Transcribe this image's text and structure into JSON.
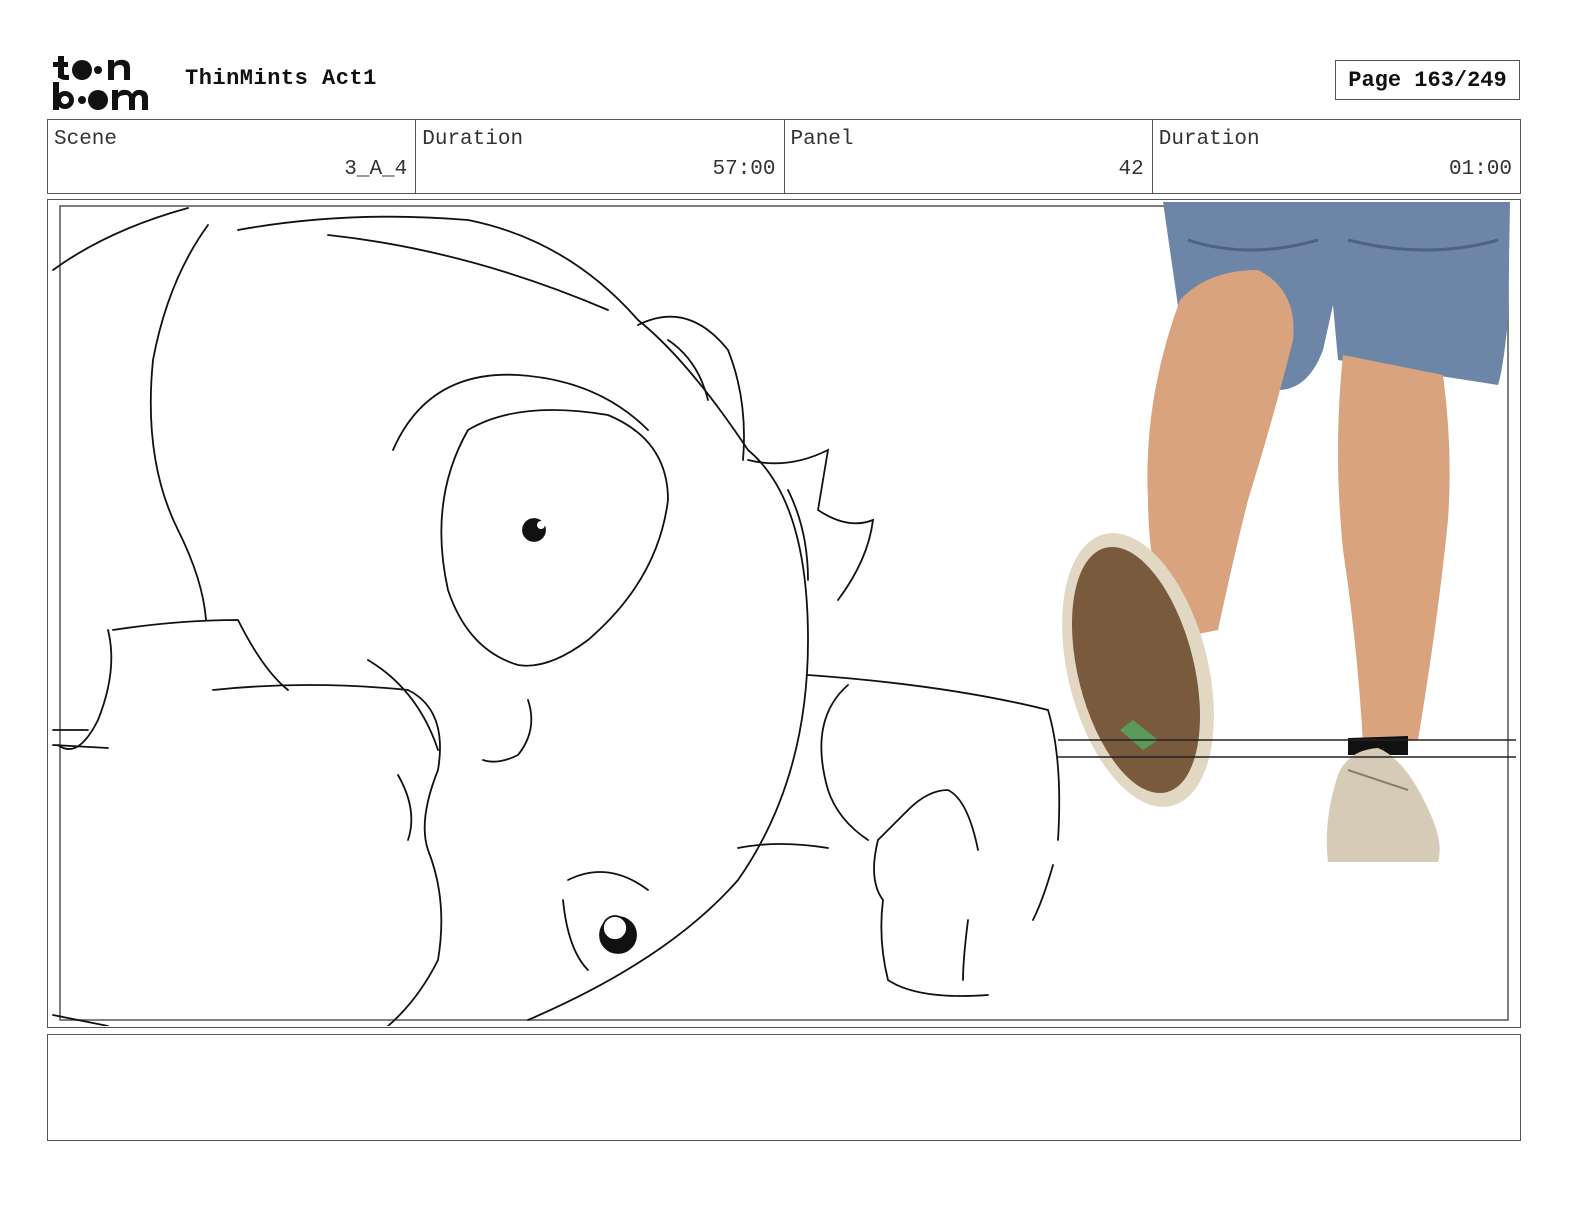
{
  "header": {
    "logo_name": "toon boom",
    "title": "ThinMints Act1",
    "page_label": "Page 163/249"
  },
  "info": {
    "scene_label": "Scene",
    "scene_value": "3_A_4",
    "duration_label": "Duration",
    "duration_value": "57:00",
    "panel_label": "Panel",
    "panel_value": "42",
    "panel_duration_label": "Duration",
    "panel_duration_value": "01:00"
  },
  "caption": {
    "text": ""
  }
}
